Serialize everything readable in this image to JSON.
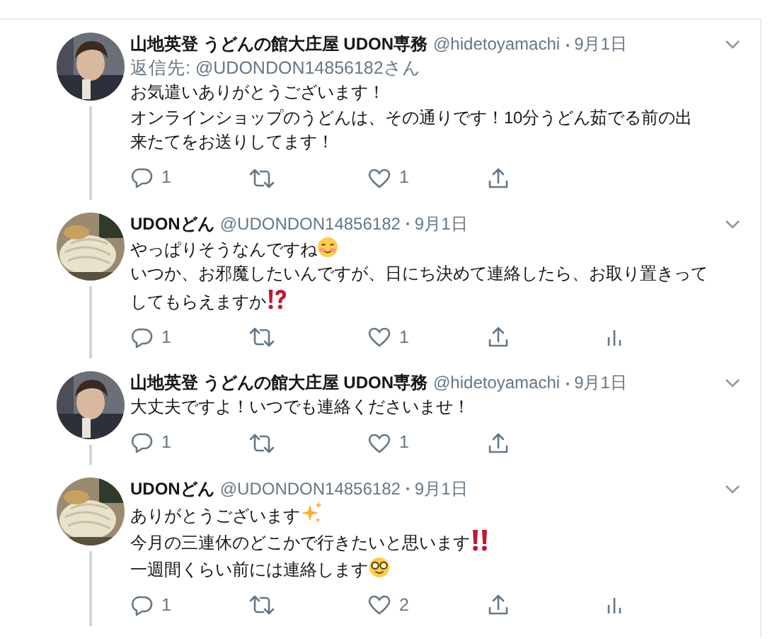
{
  "tweets": [
    {
      "author": {
        "name": "山地英登 うどんの館大庄屋 UDON専務",
        "handle": "@hidetoyamachi",
        "date": "9月1日"
      },
      "reply_to": {
        "prefix": "返信先:",
        "handle": "@UDONDON14856182",
        "suffix": "さん"
      },
      "lines": [
        {
          "text": "お気遣いありがとうございます！",
          "kind": "plain"
        },
        {
          "text": "オンラインショップのうどんは、その通りです！10分うどん茹でる前の出来たてをお送りしてます！",
          "kind": "plain"
        }
      ],
      "actions": {
        "reply": "1",
        "like": "1"
      },
      "analytics": false
    },
    {
      "author": {
        "name": "UDONどん",
        "handle": "@UDONDON14856182",
        "date": "9月1日"
      },
      "lines": [
        {
          "text": "やっぱりそうなんですね",
          "kind": "blush"
        },
        {
          "text": "いつか、お邪魔したいんですが、日にち決めて連絡したら、お取り置きってしてもらえますか",
          "kind": "interrobang"
        }
      ],
      "actions": {
        "reply": "1",
        "like": "1"
      },
      "analytics": true
    },
    {
      "author": {
        "name": "山地英登 うどんの館大庄屋 UDON専務",
        "handle": "@hidetoyamachi",
        "date": "9月1日"
      },
      "lines": [
        {
          "text": "大丈夫ですよ！いつでも連絡くださいませ！",
          "kind": "plain"
        }
      ],
      "actions": {
        "reply": "1",
        "like": "1"
      },
      "analytics": false
    },
    {
      "author": {
        "name": "UDONどん",
        "handle": "@UDONDON14856182",
        "date": "9月1日"
      },
      "lines": [
        {
          "text": "ありがとうございます",
          "kind": "sparkles"
        },
        {
          "text": "今月の三連休のどこかで行きたいと思います",
          "kind": "double-exclamation"
        },
        {
          "text": "一週間くらい前には連絡します",
          "kind": "nerd"
        }
      ],
      "actions": {
        "reply": "1",
        "like": "2"
      },
      "analytics": true
    }
  ]
}
